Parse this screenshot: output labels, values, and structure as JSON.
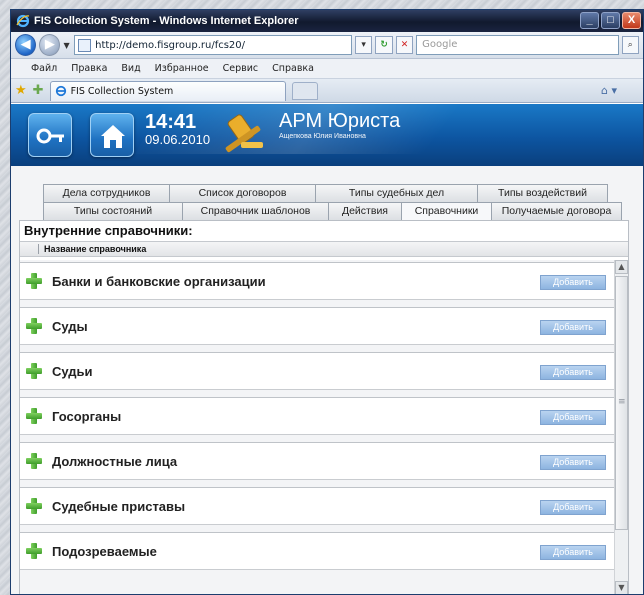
{
  "window": {
    "title": "FIS Collection System - Windows Internet Explorer",
    "controls": [
      "_",
      "□",
      "X"
    ]
  },
  "browser": {
    "url": "http://demo.fisgroup.ru/fcs20/",
    "search_placeholder": "Google",
    "menu": [
      "Файл",
      "Правка",
      "Вид",
      "Избранное",
      "Сервис",
      "Справка"
    ],
    "tab_title": "FIS Collection System"
  },
  "header": {
    "time": "14:41",
    "date": "09.06.2010",
    "app_title": "АРМ Юриста",
    "user": "Ащепкова Юлия Ивановна"
  },
  "nav": {
    "row1": [
      "Дела сотрудников",
      "Список договоров",
      "Типы судебных дел",
      "Типы воздействий"
    ],
    "row2": [
      "Типы состояний",
      "Справочник шаблонов",
      "Действия",
      "Справочники",
      "Получаемые договора"
    ],
    "active": "Справочники"
  },
  "panel": {
    "title": "Внутренние справочники:",
    "column_header": "Название справочника",
    "add_label": "Добавить",
    "items": [
      "Банки и банковские организации",
      "Суды",
      "Судьи",
      "Госорганы",
      "Должностные лица",
      "Судебные приставы",
      "Подозреваемые"
    ]
  }
}
